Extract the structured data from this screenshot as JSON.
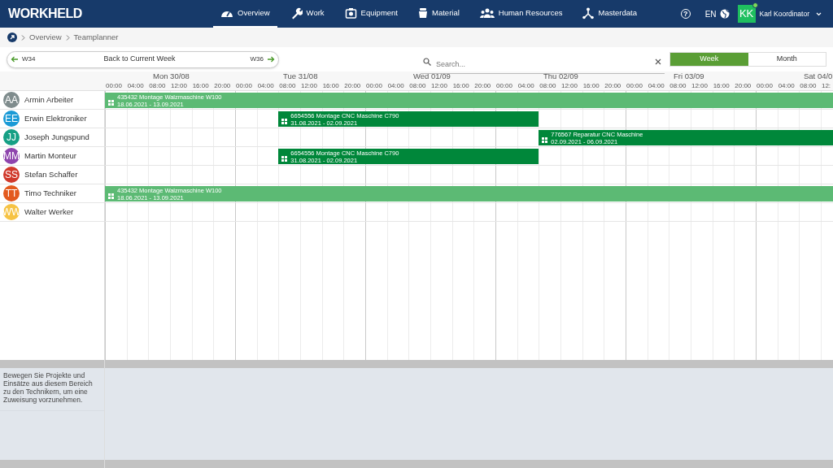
{
  "app": {
    "logo": "WORKHELD"
  },
  "nav": [
    {
      "label": "Overview",
      "selected": true
    },
    {
      "label": "Work",
      "selected": false
    },
    {
      "label": "Equipment",
      "selected": false
    },
    {
      "label": "Material",
      "selected": false
    },
    {
      "label": "Human Resources",
      "selected": false
    },
    {
      "label": "Masterdata",
      "selected": false
    }
  ],
  "user_bar": {
    "help": "?",
    "language": "EN",
    "initials": "KK",
    "name": "Karl Koordinator",
    "online": true
  },
  "breadcrumb": [
    "Overview",
    "Teamplanner"
  ],
  "week_nav": {
    "previous": "W34",
    "current": "Back to Current Week",
    "next": "W36"
  },
  "search": {
    "placeholder": "Search..."
  },
  "view_toggle": [
    {
      "label": "Week",
      "selected": true
    },
    {
      "label": "Month",
      "selected": false
    }
  ],
  "timeline": {
    "days": [
      {
        "label": "Mon 30/08",
        "hours": [
          "00:00",
          "04:00",
          "08:00",
          "12:00",
          "16:00",
          "20:00"
        ]
      },
      {
        "label": "Tue 31/08",
        "hours": [
          "00:00",
          "04:00",
          "08:00",
          "12:00",
          "16:00",
          "20:00"
        ]
      },
      {
        "label": "Wed 01/09",
        "hours": [
          "00:00",
          "04:00",
          "08:00",
          "12:00",
          "16:00",
          "20:00"
        ]
      },
      {
        "label": "Thu 02/09",
        "hours": [
          "00:00",
          "04:00",
          "08:00",
          "12:00",
          "16:00",
          "20:00"
        ]
      },
      {
        "label": "Fri 03/09",
        "hours": [
          "00:00",
          "04:00",
          "08:00",
          "12:00",
          "16:00",
          "20:00"
        ]
      },
      {
        "label": "Sat 04/0",
        "hours": [
          "00:00",
          "04:00",
          "08:00",
          "12:"
        ]
      }
    ]
  },
  "technicians": [
    {
      "initials": "AA",
      "name": "Armin Arbeiter",
      "color": "#7f8c8d",
      "bookings": [
        {
          "title": "435432 Montage Walzmaschine W100",
          "dates": "18.06.2021 - 13.09.2021",
          "color": "#5cba74"
        }
      ]
    },
    {
      "initials": "EE",
      "name": "Erwin Elektroniker",
      "color": "#1a9ad6",
      "bookings": [
        {
          "title": "6654556 Montage CNC Maschine C790",
          "dates": "31.08.2021 - 02.09.2021",
          "color": "#00873a"
        }
      ]
    },
    {
      "initials": "JJ",
      "name": "Joseph Jungspund",
      "color": "#16a085",
      "bookings": [
        {
          "title": "776567 Reparatur CNC Maschine",
          "dates": "02.09.2021 - 06.09.2021",
          "color": "#00873a"
        }
      ]
    },
    {
      "initials": "MM",
      "name": "Martin Monteur",
      "color": "#8e44ad",
      "bookings": [
        {
          "title": "6654556 Montage CNC Maschine C790",
          "dates": "31.08.2021 - 02.09.2021",
          "color": "#00873a"
        }
      ]
    },
    {
      "initials": "SS",
      "name": "Stefan Schaffer",
      "color": "#d0392b"
    },
    {
      "initials": "TT",
      "name": "Timo Techniker",
      "color": "#e35a1e",
      "bookings": [
        {
          "title": "435432 Montage Walzmaschine W100",
          "dates": "18.06.2021 - 13.09.2021",
          "color": "#5cba74"
        }
      ]
    },
    {
      "initials": "WW",
      "name": "Walter Werker",
      "color": "#f6c344"
    }
  ],
  "pool": {
    "hint": "Bewegen Sie Projekte und Einsätze aus diesem Bereich zu den Technikern, um eine Zuweisung vorzunehmen."
  }
}
